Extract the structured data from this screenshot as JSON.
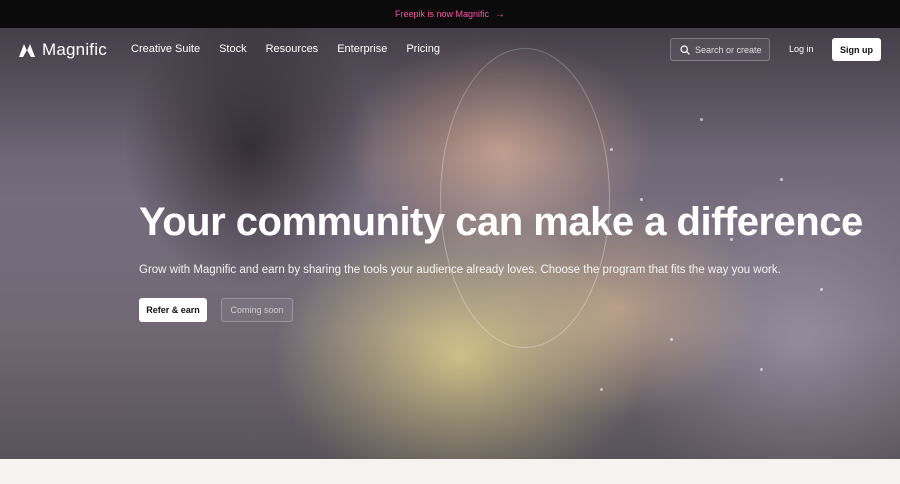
{
  "announcement": {
    "text": "Freepik is now Magnific",
    "arrow": "→"
  },
  "header": {
    "logo_text": "Magnific",
    "nav": [
      "Creative Suite",
      "Stock",
      "Resources",
      "Enterprise",
      "Pricing"
    ],
    "search_placeholder": "Search or create",
    "login_label": "Log in",
    "signup_label": "Sign up"
  },
  "hero": {
    "title": "Your community can make a difference",
    "subtitle": "Grow with Magnific and earn by sharing the tools your audience already loves. Choose the program that fits the way you work.",
    "primary_cta": "Refer & earn",
    "secondary_cta": "Coming soon"
  },
  "colors": {
    "announcement_text": "#ff4fa8",
    "announcement_bg": "#0b0b0b",
    "page_bg": "#f4f3ef"
  },
  "icons": [
    "magnific-logo-icon",
    "search-icon",
    "arrow-right-icon"
  ]
}
